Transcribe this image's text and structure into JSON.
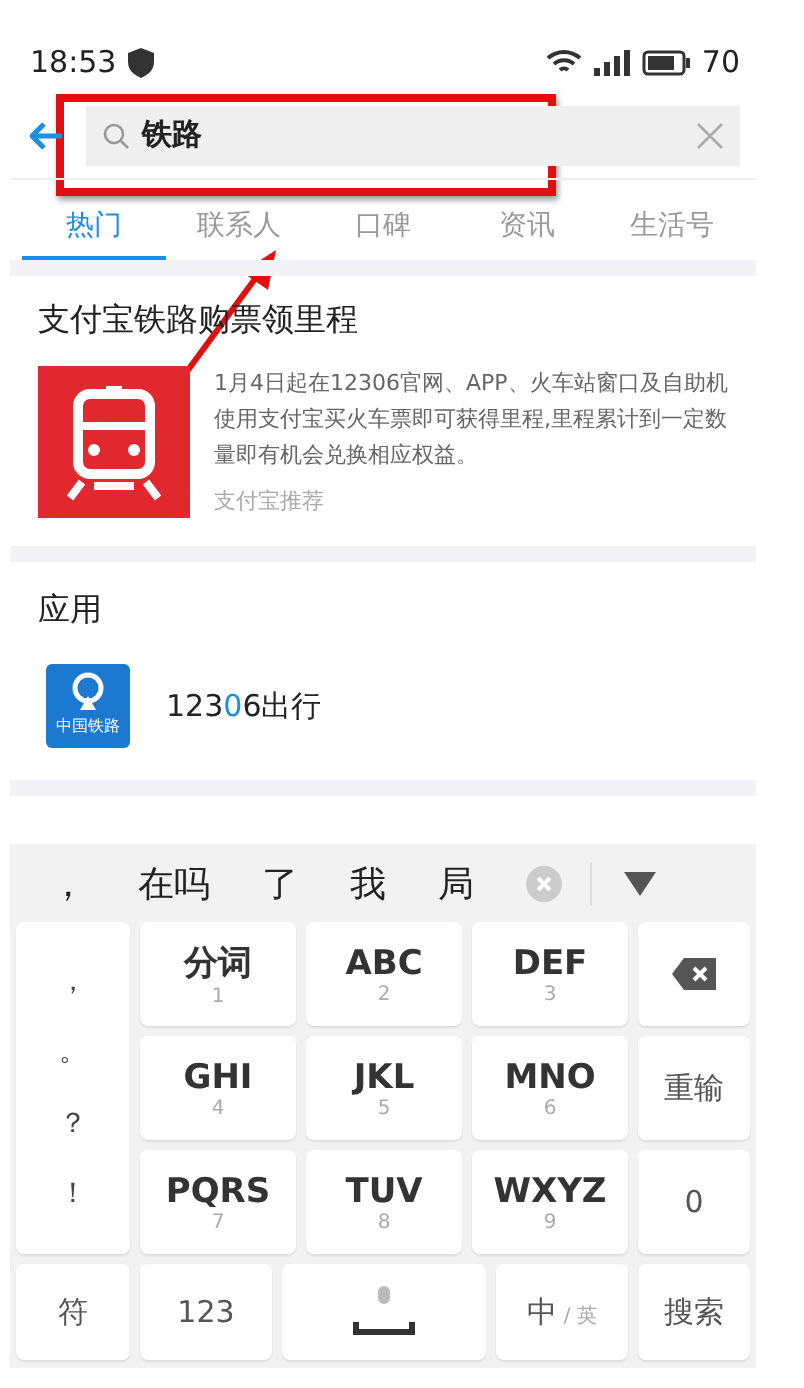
{
  "status_bar": {
    "time": "18:53",
    "battery": "70"
  },
  "search": {
    "query": "铁路"
  },
  "tabs": [
    {
      "label": "热门",
      "selected": true
    },
    {
      "label": "联系人",
      "selected": false
    },
    {
      "label": "口碑",
      "selected": false
    },
    {
      "label": "资讯",
      "selected": false
    },
    {
      "label": "生活号",
      "selected": false
    }
  ],
  "card": {
    "title": "支付宝铁路购票领里程",
    "description": "1月4日起在12306官网、APP、火车站窗口及自助机使用支付宝买火车票即可获得里程,里程累计到一定数量即有机会兑换相应权益。",
    "source": "支付宝推荐"
  },
  "apps_section": {
    "heading": "应用",
    "apps": [
      {
        "logo_text": "中国铁路",
        "name_parts": [
          {
            "text": "123",
            "highlighted": false
          },
          {
            "text": "0",
            "highlighted": true
          },
          {
            "text": "6出行",
            "highlighted": false
          }
        ]
      }
    ]
  },
  "keyboard": {
    "candidates": [
      "，",
      "在吗",
      "了",
      "我",
      "局"
    ],
    "symbols": [
      "，",
      "。",
      "？",
      "！"
    ],
    "rows": [
      [
        {
          "kind": "letter",
          "label": "分词",
          "sub": "1"
        },
        {
          "kind": "letter",
          "label": "ABC",
          "sub": "2"
        },
        {
          "kind": "letter",
          "label": "DEF",
          "sub": "3"
        },
        {
          "kind": "backspace"
        }
      ],
      [
        {
          "kind": "letter",
          "label": "GHI",
          "sub": "4"
        },
        {
          "kind": "letter",
          "label": "JKL",
          "sub": "5"
        },
        {
          "kind": "letter",
          "label": "MNO",
          "sub": "6"
        },
        {
          "kind": "function",
          "label": "重输"
        }
      ],
      [
        {
          "kind": "letter",
          "label": "PQRS",
          "sub": "7"
        },
        {
          "kind": "letter",
          "label": "TUV",
          "sub": "8"
        },
        {
          "kind": "letter",
          "label": "WXYZ",
          "sub": "9"
        },
        {
          "kind": "function",
          "label": "0"
        }
      ]
    ],
    "bottom": [
      {
        "kind": "function",
        "label": "符"
      },
      {
        "kind": "function",
        "label": "123"
      },
      {
        "kind": "space"
      },
      {
        "kind": "lang",
        "label": "中",
        "sub": "/ 英"
      },
      {
        "kind": "function",
        "label": "搜索"
      }
    ]
  }
}
